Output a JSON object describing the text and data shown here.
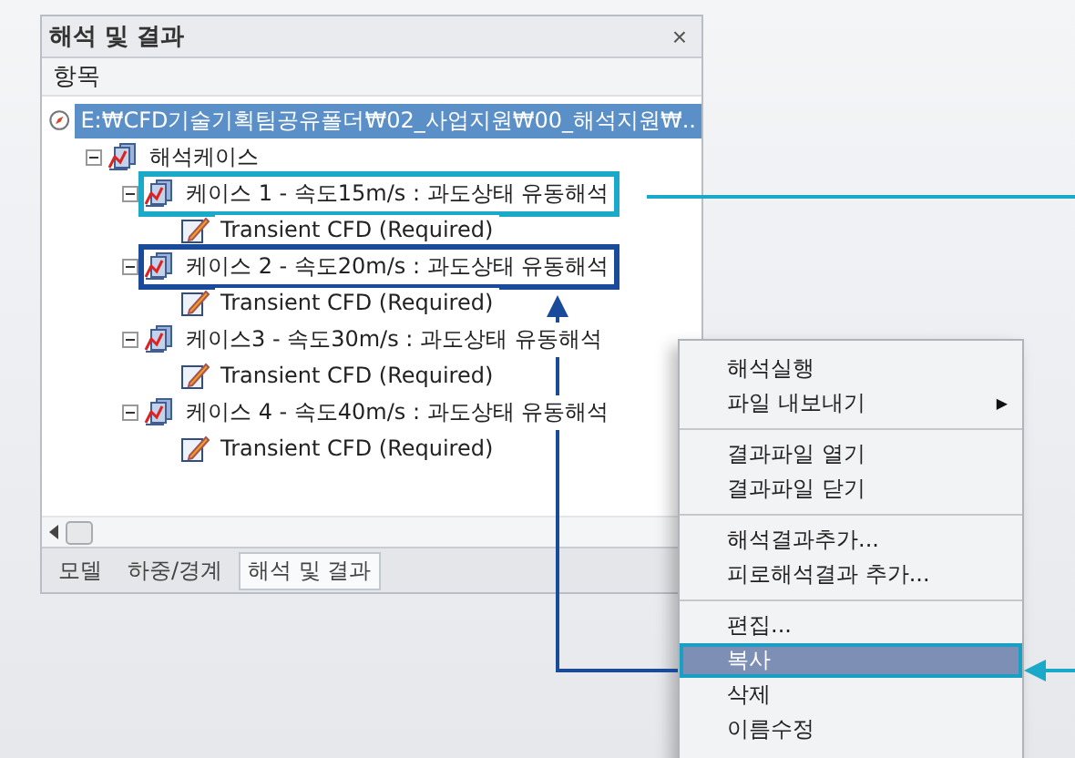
{
  "panel": {
    "title": "해석 및 결과",
    "close": "×",
    "header": "항목"
  },
  "tree": [
    {
      "label": "E:₩CFD기술기획팀공유폴더₩02_사업지원₩00_해석지원₩..",
      "kind": "root",
      "selected": true,
      "children": [
        {
          "label": "해석케이스",
          "kind": "group",
          "expanded": true,
          "selected": false,
          "children": [
            {
              "label": "케이스 1 - 속도15m/s : 과도상태 유동해석",
              "kind": "case",
              "expanded": true,
              "selected": false,
              "color": "#1aa9c9",
              "children": [
                {
                  "label": "Transient CFD (Required)",
                  "kind": "study",
                  "selected": false
                }
              ]
            },
            {
              "label": "케이스 2 - 속도20m/s : 과도상태 유동해석",
              "kind": "case",
              "expanded": true,
              "selected": false,
              "color": "#1a4a9a",
              "children": [
                {
                  "label": "Transient CFD (Required)",
                  "kind": "study",
                  "selected": false
                }
              ]
            },
            {
              "label": "케이스3 - 속도30m/s : 과도상태 유동해석",
              "kind": "case",
              "expanded": true,
              "selected": false,
              "children": [
                {
                  "label": "Transient CFD (Required)",
                  "kind": "study",
                  "selected": false
                }
              ]
            },
            {
              "label": "케이스 4 - 속도40m/s : 과도상태 유동해석",
              "kind": "case",
              "expanded": true,
              "selected": false,
              "children": [
                {
                  "label": "Transient CFD (Required)",
                  "kind": "study",
                  "selected": false
                }
              ]
            }
          ]
        }
      ]
    }
  ],
  "tabs": [
    {
      "label": "모델",
      "selected": false
    },
    {
      "label": "하중/경계",
      "selected": false
    },
    {
      "label": "해석 및 결과",
      "selected": true
    }
  ],
  "context_menu": [
    [
      {
        "label": "해석실행",
        "selected": false
      },
      {
        "label": "파일 내보내기",
        "submenu": "▶",
        "selected": false
      }
    ],
    [
      {
        "label": "결과파일 열기",
        "selected": false
      },
      {
        "label": "결과파일 닫기",
        "selected": false
      }
    ],
    [
      {
        "label": "해석결과추가...",
        "selected": false
      },
      {
        "label": "피로해석결과 추가...",
        "selected": false
      }
    ],
    [
      {
        "label": "편집...",
        "selected": false
      },
      {
        "label": "복사",
        "selected": true
      },
      {
        "label": "삭제",
        "selected": false
      },
      {
        "label": "이름수정",
        "selected": false
      }
    ]
  ]
}
